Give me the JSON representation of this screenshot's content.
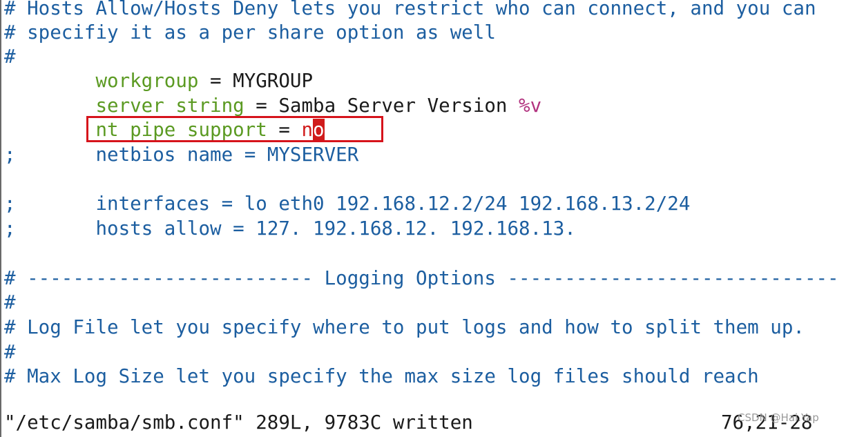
{
  "editor": {
    "lines": [
      {
        "comment": "# Hosts Allow/Hosts Deny lets you restrict who can connect, and you can"
      },
      {
        "comment": "# specifiy it as a per share option as well"
      },
      {
        "comment": "#"
      },
      {
        "indent": "        ",
        "key": "workgroup",
        "eq": " = ",
        "value": "MYGROUP"
      },
      {
        "indent": "        ",
        "key": "server string",
        "eq": " = ",
        "value": "Samba Server Version ",
        "macro": "%v"
      },
      {
        "indent": "        ",
        "key": "nt pipe support",
        "eq": " = ",
        "value_before_cursor": "n",
        "cursor_char": "o"
      },
      {
        "prefix": ";",
        "indent": "       ",
        "text": "netbios name = MYSERVER"
      },
      {
        "text": ""
      },
      {
        "prefix": ";",
        "indent": "       ",
        "text": "interfaces = lo eth0 192.168.12.2/24 192.168.13.2/24"
      },
      {
        "prefix": ";",
        "indent": "       ",
        "text": "hosts allow = 127. 192.168.12. 192.168.13."
      },
      {
        "text": ""
      },
      {
        "comment": "# ------------------------- Logging Options -----------------------------"
      },
      {
        "comment": "#"
      },
      {
        "comment": "# Log File let you specify where to put logs and how to split them up."
      },
      {
        "comment": "#"
      },
      {
        "comment": "# Max Log Size let you specify the max size log files should reach"
      }
    ]
  },
  "status": {
    "message": "\"/etc/samba/smb.conf\" 289L, 9783C written",
    "position": "76,21-28"
  },
  "watermark": "CSDN @Hai.Yap",
  "colors": {
    "comment": "#1c5ea0",
    "keyword": "#5b9a22",
    "macro": "#b2337f",
    "cursor": "#d01b1b",
    "highlight_box": "#d6131b"
  }
}
